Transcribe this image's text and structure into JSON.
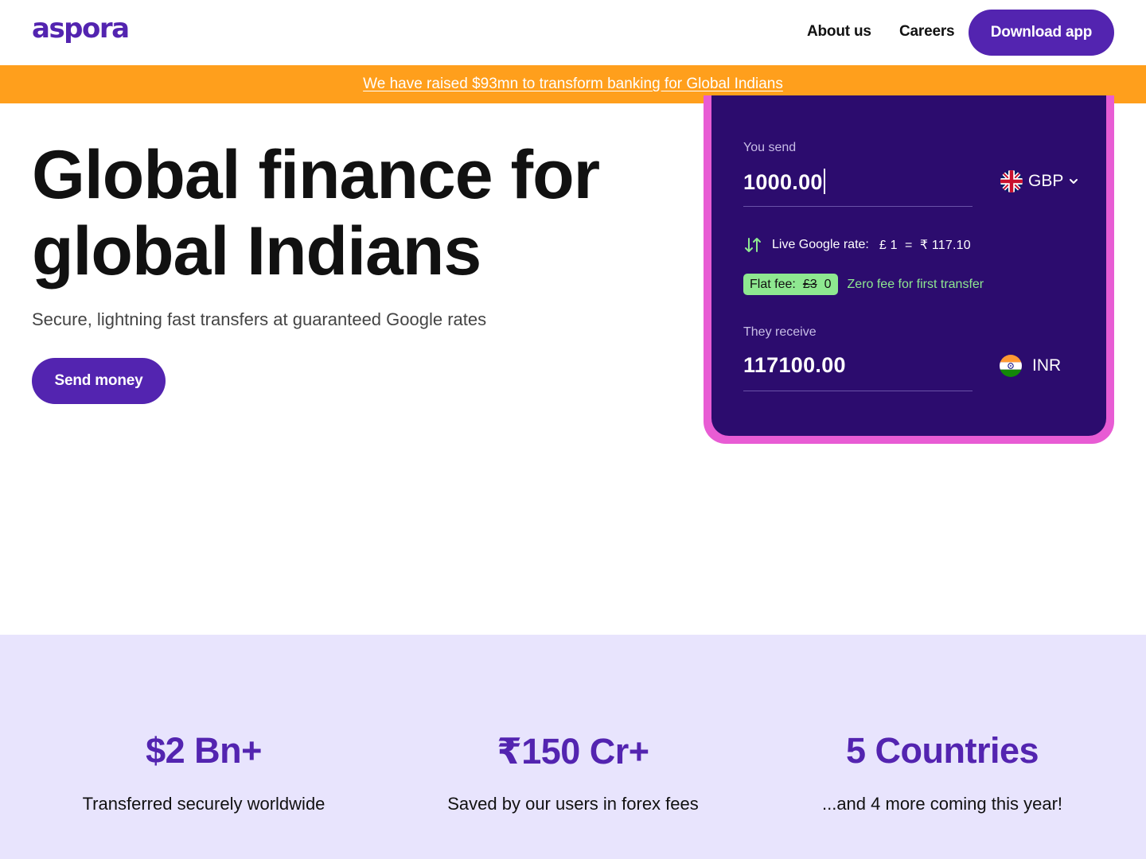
{
  "header": {
    "logo_text": "aspora",
    "nav": [
      {
        "label": "About us"
      },
      {
        "label": "Careers"
      }
    ],
    "cta_label": "Download app"
  },
  "banner": {
    "text": "We have raised $93mn to transform banking for Global Indians"
  },
  "hero": {
    "title_line1": "Global finance for",
    "title_line2": "global Indians",
    "subtitle": "Secure, lightning fast transfers at guaranteed Google rates",
    "cta_label": "Send money"
  },
  "calculator": {
    "send_label": "You send",
    "send_amount": "1000.00",
    "send_currency": "GBP",
    "rate_label": "Live Google rate:",
    "rate_value": "£ 1  =  ₹ 117.10",
    "fee_label": "Flat fee:",
    "fee_old": "£3",
    "fee_new": "0",
    "fee_note": "Zero fee for first transfer",
    "receive_label": "They receive",
    "receive_amount": "117100.00",
    "receive_currency": "INR",
    "icons": [
      "uk-flag-icon",
      "chevron-down-icon",
      "swap-arrows-icon",
      "india-flag-icon"
    ]
  },
  "stats": [
    {
      "value": "$2 Bn+",
      "desc": "Transferred securely worldwide"
    },
    {
      "value": "₹150 Cr+",
      "desc": "Saved by our users in forex fees"
    },
    {
      "value": "5 Countries",
      "desc": "...and 4 more coming this year!"
    }
  ],
  "colors": {
    "brand_purple": "#5324b0",
    "card_bg": "#2c0c6e",
    "card_border": "#e85cd4",
    "banner_orange": "#ff9f1c",
    "fee_green": "#8ee890",
    "stats_bg": "#e8e4fd"
  }
}
